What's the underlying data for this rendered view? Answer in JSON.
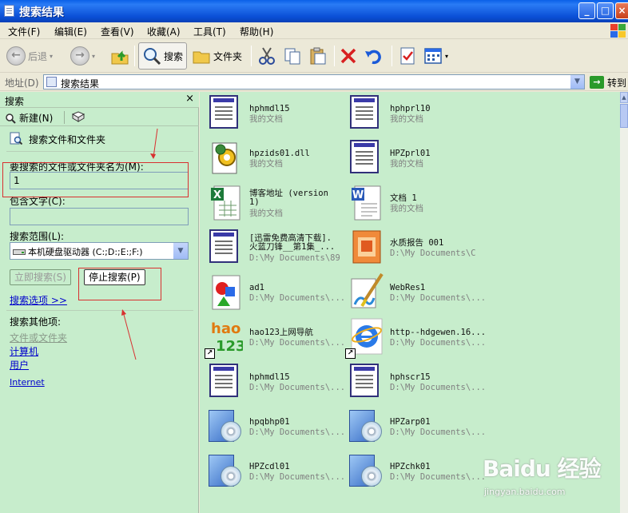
{
  "window": {
    "title": "搜索结果"
  },
  "menu": [
    "文件(F)",
    "编辑(E)",
    "查看(V)",
    "收藏(A)",
    "工具(T)",
    "帮助(H)"
  ],
  "toolbar": {
    "back": "后退",
    "search": "搜索",
    "folders": "文件夹"
  },
  "address": {
    "label": "地址(D)",
    "value": "搜索结果",
    "go": "转到"
  },
  "search_pane": {
    "title": "搜索",
    "new_label": "新建(N)",
    "task": "搜索文件和文件夹",
    "name_label": "要搜索的文件或文件夹名为(M):",
    "name_value": "1",
    "contains_label": "包含文字(C):",
    "contains_value": "",
    "scope_label": "搜索范围(L):",
    "scope_value": "本机硬盘驱动器 (C:;D:;E:;F:)",
    "search_now": "立即搜索(S)",
    "stop_search": "停止搜索(P)",
    "options_link": "搜索选项 >>",
    "other_label": "搜索其他项:",
    "other_items": [
      "文件或文件夹",
      "计算机",
      "用户"
    ],
    "internet": "Internet"
  },
  "results": [
    {
      "name": "hphmdl15",
      "loc": "我的文档",
      "icon": "doc"
    },
    {
      "name": "hphprl10",
      "loc": "我的文档",
      "icon": "doc"
    },
    {
      "name": "hpzids01.dll",
      "loc": "我的文档",
      "icon": "dll"
    },
    {
      "name": "HPZprl01",
      "loc": "我的文档",
      "icon": "doc"
    },
    {
      "name": "博客地址 (version\n1)",
      "loc": "我的文档",
      "icon": "excel"
    },
    {
      "name": "文档 1",
      "loc": "我的文档",
      "icon": "word"
    },
    {
      "name": "[迅雷免费高清下载].\n火蓝刀锋__第1集_...",
      "loc": "D:\\My Documents\\89",
      "icon": "doc"
    },
    {
      "name": "水质报告 001",
      "loc": "D:\\My Documents\\C",
      "icon": "ppt"
    },
    {
      "name": "ad1",
      "loc": "D:\\My Documents\\...",
      "icon": "shapes"
    },
    {
      "name": "WebRes1",
      "loc": "D:\\My Documents\\...",
      "icon": "paint"
    },
    {
      "name": "hao123上网导航",
      "loc": "D:\\My Documents\\...",
      "icon": "hao123"
    },
    {
      "name": "http--hdgewen.16...",
      "loc": "D:\\My Documents\\...",
      "icon": "ie"
    },
    {
      "name": "hphmdl15",
      "loc": "D:\\My Documents\\...",
      "icon": "doc"
    },
    {
      "name": "hphscr15",
      "loc": "D:\\My Documents\\...",
      "icon": "doc"
    },
    {
      "name": "hpqbhp01",
      "loc": "D:\\My Documents\\...",
      "icon": "cd"
    },
    {
      "name": "HPZarp01",
      "loc": "D:\\My Documents\\...",
      "icon": "cd"
    },
    {
      "name": "HPZcdl01",
      "loc": "D:\\My Documents\\...",
      "icon": "cd"
    },
    {
      "name": "HPZchk01",
      "loc": "D:\\My Documents\\...",
      "icon": "cd"
    }
  ],
  "watermark": {
    "logo": "Baidu 经验",
    "url": "jingyan.baidu.com"
  }
}
